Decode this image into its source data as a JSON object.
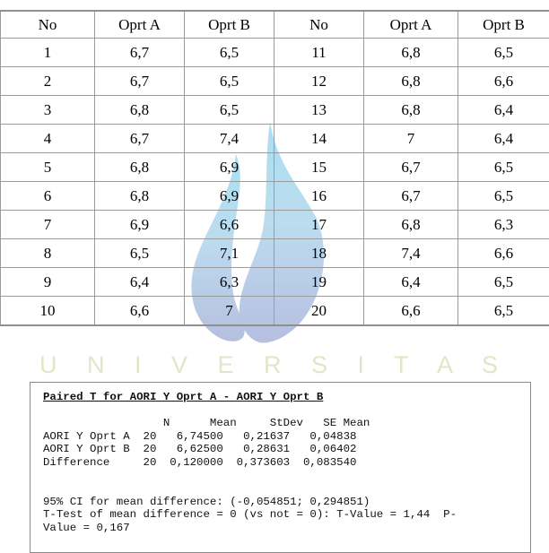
{
  "watermark": {
    "text": "U N I V E R S I T A S",
    "leaf_color_top": "#bfe6f5",
    "leaf_color_bottom": "#b9c2e2",
    "word_color": "#e2e6c8"
  },
  "table": {
    "headers": [
      "No",
      "Oprt A",
      "Oprt B",
      "No",
      "Oprt A",
      "Oprt B"
    ],
    "rows": [
      [
        "1",
        "6,7",
        "6,5",
        "11",
        "6,8",
        "6,5"
      ],
      [
        "2",
        "6,7",
        "6,5",
        "12",
        "6,8",
        "6,6"
      ],
      [
        "3",
        "6,8",
        "6,5",
        "13",
        "6,8",
        "6,4"
      ],
      [
        "4",
        "6,7",
        "7,4",
        "14",
        "7",
        "6,4"
      ],
      [
        "5",
        "6,8",
        "6,9",
        "15",
        "6,7",
        "6,5"
      ],
      [
        "6",
        "6,8",
        "6,9",
        "16",
        "6,7",
        "6,5"
      ],
      [
        "7",
        "6,9",
        "6,6",
        "17",
        "6,8",
        "6,3"
      ],
      [
        "8",
        "6,5",
        "7,1",
        "18",
        "7,4",
        "6,6"
      ],
      [
        "9",
        "6,4",
        "6,3",
        "19",
        "6,4",
        "6,5"
      ],
      [
        "10",
        "6,6",
        "7",
        "20",
        "6,6",
        "6,5"
      ]
    ]
  },
  "stats_output": {
    "title": "Paired T for AORI Y Oprt A - AORI Y Oprt B",
    "column_header_line": "                  N      Mean     StDev   SE Mean",
    "row_oprt_a": "AORI Y Oprt A  20   6,74500   0,21637   0,04838",
    "row_oprt_b": "AORI Y Oprt B  20   6,62500   0,28631   0,06402",
    "row_difference": "Difference     20  0,120000  0,373603  0,083540",
    "ci_line": "95% CI for mean difference: (-0,054851; 0,294851)",
    "ttest_line": "T-Test of mean difference = 0 (vs not = 0): T-Value = 1,44  P-",
    "ttest_line_cont": "Value = 0,167"
  }
}
